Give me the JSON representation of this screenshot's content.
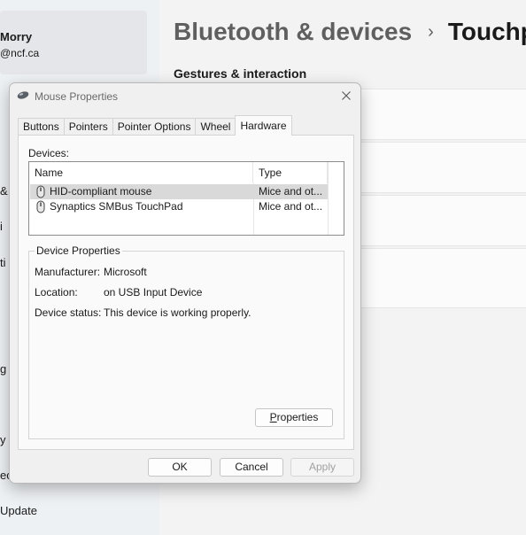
{
  "settings": {
    "profile": {
      "name": "Morry",
      "email": "@ncf.ca"
    },
    "sidebar_fragments": [
      "&",
      "i",
      "ti",
      "g",
      "y",
      "ec",
      "Update"
    ],
    "breadcrumb": {
      "parent": "Bluetooth & devices",
      "separator": "›",
      "current": "Touchpa"
    },
    "section_title": "Gestures & interaction"
  },
  "dialog": {
    "title": "Mouse Properties",
    "tabs": [
      "Buttons",
      "Pointers",
      "Pointer Options",
      "Wheel",
      "Hardware"
    ],
    "active_tab": "Hardware",
    "devices_label": "Devices:",
    "columns": {
      "name": "Name",
      "type": "Type"
    },
    "devices": [
      {
        "name": "HID-compliant mouse",
        "type": "Mice and ot...",
        "selected": true
      },
      {
        "name": "Synaptics SMBus TouchPad",
        "type": "Mice and ot...",
        "selected": false
      }
    ],
    "device_properties": {
      "legend": "Device Properties",
      "manufacturer_label": "Manufacturer:",
      "manufacturer_value": "Microsoft",
      "location_label": "Location:",
      "location_value": "on USB Input Device",
      "status_label": "Device status:",
      "status_value": "This device is working properly.",
      "properties_button_prefix": "P",
      "properties_button_rest": "roperties"
    },
    "buttons": {
      "ok": "OK",
      "cancel": "Cancel",
      "apply": "Apply"
    },
    "colors": {
      "selection": "#d9d9d9",
      "dialog_bg": "#f0f0f0"
    }
  }
}
